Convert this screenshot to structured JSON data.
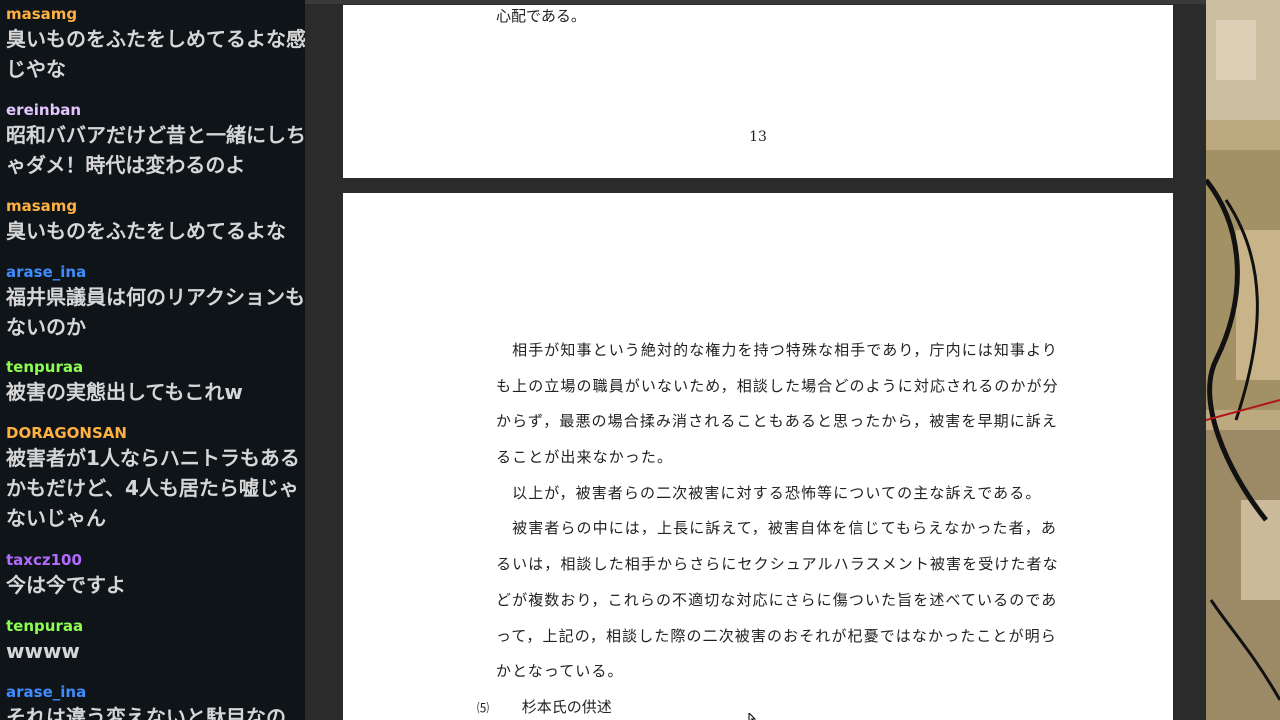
{
  "chat": {
    "messages": [
      {
        "user": "masamg",
        "color": "#ffb042",
        "text": "臭いものをふたをしめてるよな感じやな"
      },
      {
        "user": "ereinban",
        "color": "#e3c6ff",
        "text": "昭和ババアだけど昔と一緒にしちゃダメ！時代は変わるのよ"
      },
      {
        "user": "masamg",
        "color": "#ffb042",
        "text": "臭いものをふたをしめてるよな"
      },
      {
        "user": "arase_ina",
        "color": "#3f8cff",
        "text": "福井県議員は何のリアクションもないのか"
      },
      {
        "user": "tenpuraa",
        "color": "#8cff52",
        "text": "被害の実態出してもこれw"
      },
      {
        "user": "DORAGONSAN",
        "color": "#ffb042",
        "text": "被害者が1人ならハニトラもあるかもだけど、4人も居たら嘘じゃないじゃん"
      },
      {
        "user": "taxcz100",
        "color": "#b36bff",
        "text": "今は今ですよ"
      },
      {
        "user": "tenpuraa",
        "color": "#8cff52",
        "text": "wwww"
      },
      {
        "user": "arase_ina",
        "color": "#3f8cff",
        "text": "それは違う変えないと駄目なの"
      }
    ]
  },
  "document": {
    "page1": {
      "tail_text": "心配である。",
      "page_number": "13"
    },
    "page2": {
      "lines": [
        "　相手が知事という絶対的な権力を持つ特殊な相手であり，庁内には知事より",
        "も上の立場の職員がいないため，相談した場合どのように対応されるのかが分",
        "からず，最悪の場合揉み消されることもあると思ったから，被害を早期に訴え",
        "ることが出来なかった。",
        "　以上が，被害者らの二次被害に対する恐怖等についての主な訴えである。",
        "　被害者らの中には，上長に訴えて，被害自体を信じてもらえなかった者，あ",
        "るいは，相談した相手からさらにセクシュアルハラスメント被害を受けた者な",
        "どが複数おり，これらの不適切な対応にさらに傷ついた旨を述べているのであ",
        "って，上記の，相談した際の二次被害のおそれが杞憂ではなかったことが明ら",
        "かとなっている。"
      ],
      "section_number": "⑸",
      "section_title": "杉本氏の供述"
    }
  }
}
